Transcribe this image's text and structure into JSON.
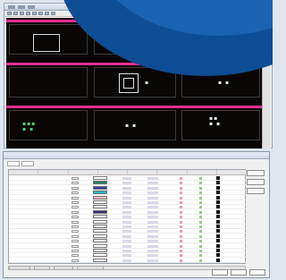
{
  "cad_window": {
    "sheets": [
      {
        "name": "sheet-row-1"
      },
      {
        "name": "sheet-row-2"
      },
      {
        "name": "sheet-row-3"
      }
    ]
  },
  "layer_dialog": {
    "rows": [
      {
        "swatch": "#ffffff"
      },
      {
        "swatch": "#1f7a5a"
      },
      {
        "swatch": "#3a3aa0"
      },
      {
        "swatch": "#28b8c2"
      },
      {
        "swatch": "#e6b5c6"
      },
      {
        "swatch": "#ffffff"
      },
      {
        "swatch": "#ffffff"
      },
      {
        "swatch": "#3d2a70"
      },
      {
        "swatch": "#ffffff"
      },
      {
        "swatch": "#ffffff"
      },
      {
        "swatch": "#ffffff"
      },
      {
        "swatch": "#ffffff"
      },
      {
        "swatch": "#ffffff"
      },
      {
        "swatch": "#ffffff"
      },
      {
        "swatch": "#ffffff"
      },
      {
        "swatch": "#ffffff"
      },
      {
        "swatch": "#ffffff"
      },
      {
        "swatch": "#ffffff"
      }
    ]
  },
  "colors": {
    "accent_band": "#e0308f",
    "brand_blue": "#0d4d96"
  }
}
